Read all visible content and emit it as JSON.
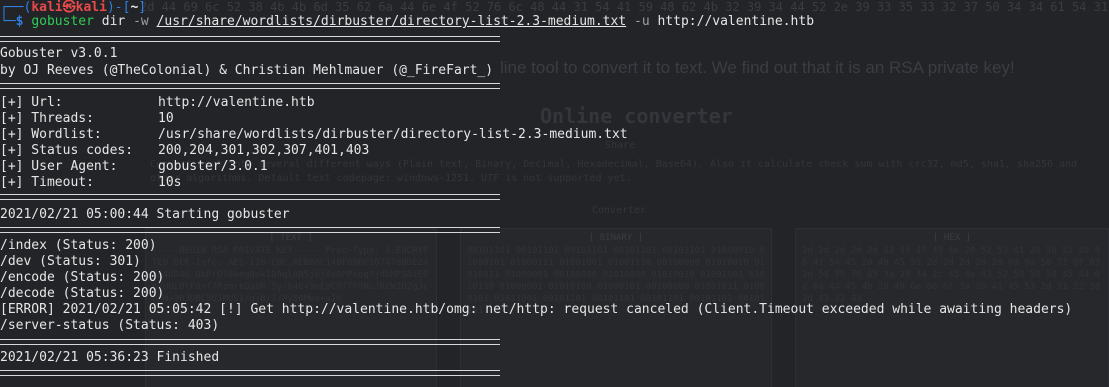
{
  "background": {
    "hex_strip": "2d 44 69 6c 52 38 4b 4b 6d 35 62 6a 44 6e 4f 52 76 6c 48 44 31 54 41 59 48 62 4b 32 39 34 44 52 2e 39 33 35 33 32 37 50 34 34 61 54 31 53 70 61 54 63 54 52 62 4e 6a 43 65 4f 55 48 57 54 4f 77 47 42 71 46",
    "sentence": "line tool to convert it to text. We find out that it is an RSA private key!",
    "heading": "Online converter",
    "sub": "Share",
    "desc": "Convert text into several different ways (Plain text, Binary, Decimal, Hexadecimal, Base64). Also it calculate check sum with crc32, md5, sha1, sha256 and other algorithms. Default text codepage: windows-1251. UTF is not supported yet.",
    "converter_label": "Converter",
    "panels": [
      {
        "header": "[ TEXT ]",
        "text": "-----BEGIN RSA PRIVATE KEY----- Proc-Type: 4,ENCRYPTED DEK-Info: AES-128-CBC,AEB88C140F69BF2074788DE24AE48D46 DbPrO78kegNuk1DAqlAN5jbjXv0PPsog3jdbMFS8iE9p3UOL0lF0xf7PzmrkDa8R 5y/b46+9nEpCMfTPhNuJRcW2U2gJcOFH+9RJDBC5UJMUS1/gjB/7/My00Mwx+aI6"
      },
      {
        "header": "[ BINARY ]",
        "text": "00101101 00101101 00101101 00101101 00101101 01000010 01000101 01000111 01001001 01001110 00100000 01010010 01010011 01000001 00100000 01010000 01010010 01001001 01010110 01000001 01010100 01000101 00100000 01001011 01000101 01011001 00101101 00101101 00101101 00101101 00101101"
      },
      {
        "header": "[ HEX ]",
        "text": "2d 2d 2d 2d 2d 42 45 47 49 4e 20 52 53 41 20 50 52 49 56 41 54 45 20 4b 45 59 2d 2d 2d 2d 2d 0d 0a 50 72 6f 63 2d 54 79 70 65 3a 20 34 2c 45 4e 43 52 59 50 54 45 44 0d 0a 44 45 4b 2d 49 6e 66 6f 3a 20 41 45 53 2d 31 32 38 2d 43 42 43"
      }
    ]
  },
  "terminal": {
    "prompt": {
      "open": "┌──(",
      "user": "kali",
      "at": "㉿",
      "host": "kali",
      "close": ")-[",
      "cwd": "~",
      "end": "]",
      "second": "└─",
      "dollar": "$"
    },
    "command": {
      "name": "gobuster",
      "sub": "dir",
      "flag_w": "-w",
      "wordlist": "/usr/share/wordlists/dirbuster/directory-list-2.3-medium.txt",
      "flag_u": "-u",
      "url": "http://valentine.htb"
    },
    "banner": [
      "Gobuster v3.0.1",
      "by OJ Reeves (@TheColonial) & Christian Mehlmauer (@_FireFart_)"
    ],
    "config": [
      {
        "key": "[+] Url:",
        "value": "http://valentine.htb"
      },
      {
        "key": "[+] Threads:",
        "value": "10"
      },
      {
        "key": "[+] Wordlist:",
        "value": "/usr/share/wordlists/dirbuster/directory-list-2.3-medium.txt"
      },
      {
        "key": "[+] Status codes:",
        "value": "200,204,301,302,307,401,403"
      },
      {
        "key": "[+] User Agent:",
        "value": "gobuster/3.0.1"
      },
      {
        "key": "[+] Timeout:",
        "value": "10s"
      }
    ],
    "start_line": "2021/02/21 05:00:44 Starting gobuster",
    "results": [
      "/index (Status: 200)",
      "/dev (Status: 301)",
      "/encode (Status: 200)",
      "/decode (Status: 200)",
      "[ERROR] 2021/02/21 05:05:42 [!] Get http://valentine.htb/omg: net/http: request canceled (Client.Timeout exceeded while awaiting headers)",
      "/server-status (Status: 403)"
    ],
    "finish_line": "2021/02/21 05:36:23 Finished"
  }
}
